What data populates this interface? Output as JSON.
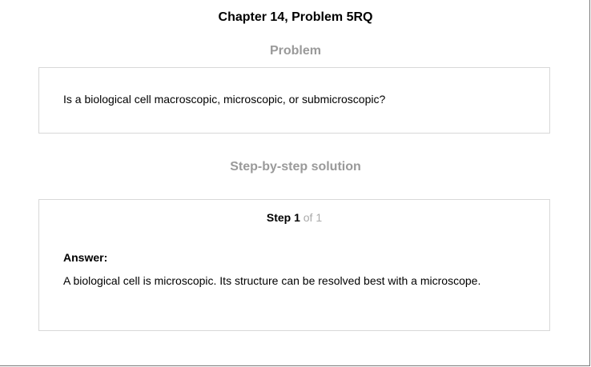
{
  "header": {
    "title": "Chapter 14, Problem 5RQ"
  },
  "problem": {
    "heading": "Problem",
    "text": "Is a biological cell macroscopic, microscopic, or submicroscopic?"
  },
  "solution": {
    "heading": "Step-by-step solution",
    "step_label": "Step 1",
    "step_of": "of 1",
    "answer_label": "Answer:",
    "answer_text": "A biological cell is microscopic. Its structure can be resolved best with a microscope."
  }
}
